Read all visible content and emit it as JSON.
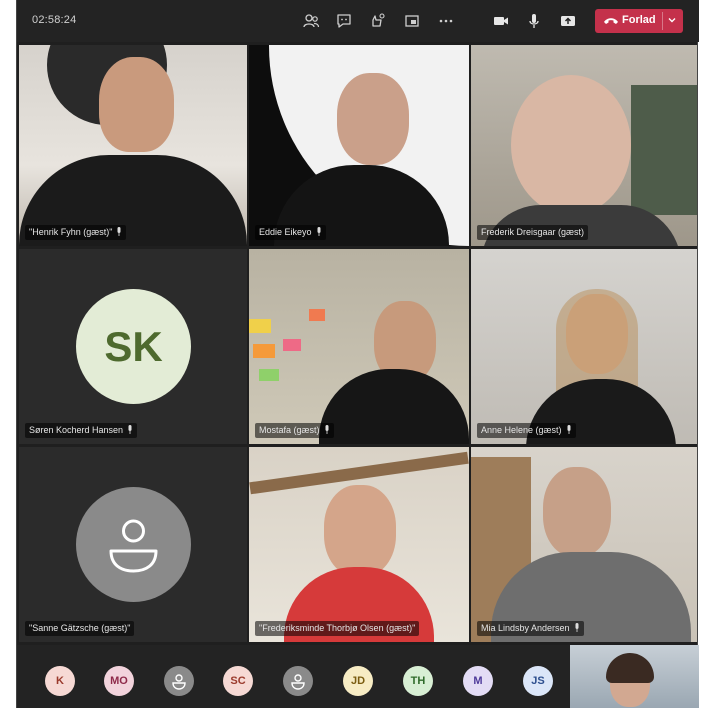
{
  "meeting": {
    "timer": "02:58:24",
    "leave_label": "Forlad"
  },
  "toolbar": {
    "icons": [
      "people-icon",
      "chat-icon",
      "reactions-icon",
      "share-icon",
      "more-icon",
      "camera-icon",
      "mic-icon",
      "share-tray-icon"
    ]
  },
  "participants": [
    {
      "name": "\"Henrik Fyhn (gæst)\""
    },
    {
      "name": "Eddie Eikeyo"
    },
    {
      "name": "Frederik Dreisgaar (gæst)"
    },
    {
      "name": "Søren Kocherd Hansen",
      "initials": "SK"
    },
    {
      "name": "Mostafa (gæst)"
    },
    {
      "name": "Anne Helene (gæst)"
    },
    {
      "name": "\"Sanne Gätzsche (gæst)\""
    },
    {
      "name": "\"Frederiksminde Thorbjø Olsen (gæst)\""
    },
    {
      "name": "Mia Lindsby Andersen"
    }
  ],
  "overflow_chips": [
    {
      "initials": "K",
      "bg": "#f6d9d4",
      "fg": "#9a3a2c"
    },
    {
      "initials": "MO",
      "bg": "#f2d3dc",
      "fg": "#8e2a4a"
    },
    {
      "initials": "",
      "bg": "#8a8a8a",
      "fg": "#ffffff"
    },
    {
      "initials": "SC",
      "bg": "#f6d9d4",
      "fg": "#9a3a2c"
    },
    {
      "initials": "",
      "bg": "#8a8a8a",
      "fg": "#ffffff"
    },
    {
      "initials": "JD",
      "bg": "#f7ecc4",
      "fg": "#7a5c10"
    },
    {
      "initials": "TH",
      "bg": "#d8efd4",
      "fg": "#2f6b2a"
    },
    {
      "initials": "M",
      "bg": "#e3dcf5",
      "fg": "#4e3a9a"
    },
    {
      "initials": "JS",
      "bg": "#dbe6f8",
      "fg": "#2d4f8e"
    }
  ],
  "colors": {
    "leave": "#c4314b",
    "background": "#1f1f1f"
  }
}
